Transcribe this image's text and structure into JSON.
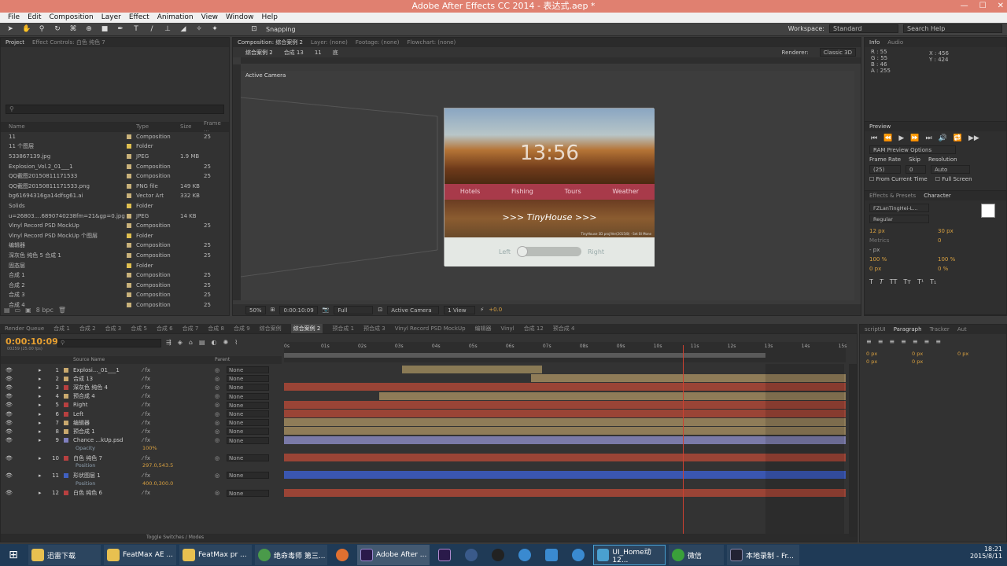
{
  "window": {
    "title": "Adobe After Effects CC 2014 - 表达式.aep *"
  },
  "menu": [
    "File",
    "Edit",
    "Composition",
    "Layer",
    "Effect",
    "Animation",
    "View",
    "Window",
    "Help"
  ],
  "toolbar": {
    "snapping": "Snapping",
    "workspace_label": "Workspace:",
    "workspace_value": "Standard",
    "search_placeholder": "Search Help"
  },
  "project": {
    "tabs": [
      "Project",
      "Effect Controls: 白色 纯色 7"
    ],
    "columns": {
      "name": "Name",
      "type": "Type",
      "size": "Size",
      "frame": "Frame ..."
    },
    "bpc": "8 bpc",
    "items": [
      {
        "name": "11",
        "type": "Composition",
        "size": "",
        "frame": "25",
        "color": "#c9b27a"
      },
      {
        "name": "11 个图层",
        "type": "Folder",
        "size": "",
        "frame": "",
        "color": "#e0c050"
      },
      {
        "name": "533867139.jpg",
        "type": "JPEG",
        "size": "1.9 MB",
        "frame": "",
        "color": "#c9b27a"
      },
      {
        "name": "Explosion_Vol.2_01___1",
        "type": "Composition",
        "size": "",
        "frame": "25",
        "color": "#c9b27a"
      },
      {
        "name": "QQ截图20150811171533",
        "type": "Composition",
        "size": "",
        "frame": "25",
        "color": "#c9b27a"
      },
      {
        "name": "QQ截图20150811171533.png",
        "type": "PNG file",
        "size": "149 KB",
        "frame": "",
        "color": "#c9b27a"
      },
      {
        "name": "bg61694316ga14dfsg61.ai",
        "type": "Vector Art",
        "size": "332 KB",
        "frame": "",
        "color": "#c9b27a"
      },
      {
        "name": "Solids",
        "type": "Folder",
        "size": "",
        "frame": "",
        "color": "#e0c050"
      },
      {
        "name": "u=26803....6890740238fm=21&gp=0.jpg",
        "type": "JPEG",
        "size": "14 KB",
        "frame": "",
        "color": "#c9b27a"
      },
      {
        "name": "Vinyl Record PSD MockUp",
        "type": "Composition",
        "size": "",
        "frame": "25",
        "color": "#c9b27a"
      },
      {
        "name": "Vinyl Record PSD MockUp 个图层",
        "type": "Folder",
        "size": "",
        "frame": "",
        "color": "#e0c050"
      },
      {
        "name": "编辑器",
        "type": "Composition",
        "size": "",
        "frame": "25",
        "color": "#c9b27a"
      },
      {
        "name": "深灰色 纯色 5 合成 1",
        "type": "Composition",
        "size": "",
        "frame": "25",
        "color": "#c9b27a"
      },
      {
        "name": "固态层",
        "type": "Folder",
        "size": "",
        "frame": "",
        "color": "#e0c050"
      },
      {
        "name": "合成 1",
        "type": "Composition",
        "size": "",
        "frame": "25",
        "color": "#c9b27a"
      },
      {
        "name": "合成 2",
        "type": "Composition",
        "size": "",
        "frame": "25",
        "color": "#c9b27a"
      },
      {
        "name": "合成 3",
        "type": "Composition",
        "size": "",
        "frame": "25",
        "color": "#c9b27a"
      },
      {
        "name": "合成 4",
        "type": "Composition",
        "size": "",
        "frame": "25",
        "color": "#c9b27a"
      }
    ]
  },
  "viewer": {
    "tabs": [
      "Composition: 综合案例 2",
      "Layer: (none)",
      "Footage: (none)",
      "Flowchart: (none)"
    ],
    "breadcrumbs": [
      "综合案例 2",
      "合成 13",
      "11",
      "底"
    ],
    "renderer": "Renderer:",
    "renderer_value": "Classic 3D",
    "active_camera": "Active Camera",
    "zoom": "50%",
    "timecode": "0:00:10:09",
    "resolution": "Full",
    "camera_select": "Active Camera",
    "views": "1 View",
    "exposure": "+0.0"
  },
  "phone": {
    "clock": "13:56",
    "nav": [
      "Hotels",
      "Fishing",
      "Tours",
      "Weather"
    ],
    "title": ">>> TinyHouse >>>",
    "caption": "TinyHouse 3D proj/Ver(2015/8) · Set Bl Mone",
    "left": "Left",
    "right": "Right"
  },
  "info": {
    "tabs": [
      "Info",
      "Audio"
    ],
    "r": "R : 55",
    "g": "G : 55",
    "b": "B : 46",
    "a": "A : 255",
    "x": "X : 456",
    "y": "Y : 424"
  },
  "preview": {
    "title": "Preview",
    "ram": "RAM Preview Options",
    "frame_rate_label": "Frame Rate",
    "skip_label": "Skip",
    "resolution_label": "Resolution",
    "frame_rate": "(25)",
    "skip": "0",
    "resolution": "Auto",
    "from_current": "From Current Time",
    "full_screen": "Full Screen"
  },
  "character": {
    "tabs": [
      "Effects & Presets",
      "Character"
    ],
    "font": "FZLanTingHei-L...",
    "style": "Regular",
    "size": "12 px",
    "leading": "30 px",
    "kerning": "Metrics",
    "tracking": "0",
    "stroke": "- px",
    "vscale": "100 %",
    "hscale": "100 %",
    "baseline": "0 px",
    "tsume": "0 %"
  },
  "paragraph": {
    "tabs": [
      "scriptUI",
      "Paragraph",
      "Tracker",
      "Aut"
    ],
    "indent": [
      "0 px",
      "0 px",
      "0 px",
      "0 px",
      "0 px"
    ]
  },
  "timeline": {
    "tabs": [
      "Render Queue",
      "合成 1",
      "合成 2",
      "合成 3",
      "合成 5",
      "合成 6",
      "合成 7",
      "合成 8",
      "合成 9",
      "综合案例",
      "综合案例 2",
      "预合成 1",
      "预合成 3",
      "Vinyl Record PSD MockUp",
      "编辑器",
      "Vinyl",
      "合成 12",
      "预合成 4"
    ],
    "active_tab": "综合案例 2",
    "timecode": "0:00:10:09",
    "timecode_sub": "00259 (25.00 fps)",
    "columns": {
      "source": "Source Name",
      "parent": "Parent"
    },
    "ruler": [
      "0s",
      "01s",
      "02s",
      "03s",
      "04s",
      "05s",
      "06s",
      "07s",
      "08s",
      "09s",
      "10s",
      "11s",
      "12s",
      "13s",
      "14s",
      "15s"
    ],
    "toggle": "Toggle Switches / Modes",
    "layers": [
      {
        "num": "1",
        "name": "Explosi..._01___1",
        "color": "#c9a96e",
        "parent": "None",
        "bar": "#8a7a55",
        "start": 0.21,
        "end": 0.46
      },
      {
        "num": "2",
        "name": "合成 13",
        "color": "#c9a96e",
        "parent": "None",
        "bar": "#8f7c58",
        "start": 0.44,
        "end": 1.0
      },
      {
        "num": "3",
        "name": "深灰色 纯色 4",
        "color": "#b84040",
        "parent": "None",
        "bar": "#9a4436",
        "start": 0.0,
        "end": 1.0
      },
      {
        "num": "4",
        "name": "预合成 4",
        "color": "#c9a96e",
        "parent": "None",
        "bar": "#8f7c58",
        "start": 0.17,
        "end": 1.0
      },
      {
        "num": "5",
        "name": "Right",
        "color": "#b84040",
        "parent": "None",
        "bar": "#9a4436",
        "start": 0.0,
        "end": 1.0
      },
      {
        "num": "6",
        "name": "Left",
        "color": "#b84040",
        "parent": "None",
        "bar": "#9a4436",
        "start": 0.0,
        "end": 1.0
      },
      {
        "num": "7",
        "name": "编辑器",
        "color": "#c9a96e",
        "parent": "None",
        "bar": "#8f7c58",
        "start": 0.0,
        "end": 1.0
      },
      {
        "num": "8",
        "name": "预合成 1",
        "color": "#c9a96e",
        "parent": "None",
        "bar": "#8f7c58",
        "start": 0.0,
        "end": 1.0
      },
      {
        "num": "9",
        "name": "Chance ...kUp.psd",
        "color": "#8080c0",
        "parent": "None",
        "bar": "#7a7aa8",
        "start": 0.0,
        "end": 1.0
      }
    ],
    "opacity": {
      "label": "Opacity",
      "value": "100%"
    },
    "layer10": {
      "num": "10",
      "name": "白色 纯色 7",
      "color": "#b84040",
      "parent": "None"
    },
    "position10": {
      "label": "Position",
      "value": "297.0,543.5"
    },
    "layer11": {
      "num": "11",
      "name": "形状图层 1",
      "color": "#4060c0",
      "parent": "None"
    },
    "position11": {
      "label": "Position",
      "value": "400.0,300.0"
    },
    "layer12": {
      "num": "12",
      "name": "白色 纯色 6",
      "color": "#b84040",
      "parent": "None"
    },
    "playhead": 0.71
  },
  "taskbar": {
    "items": [
      "迅雷下载",
      "FeatMax AE ...",
      "FeatMax pr ...",
      "绝命毒师 第三...",
      "Adobe After ...",
      "UI_Home动12...",
      "微信",
      "本地录制 - Fr..."
    ],
    "time": "18:21",
    "date": "2015/8/11"
  }
}
